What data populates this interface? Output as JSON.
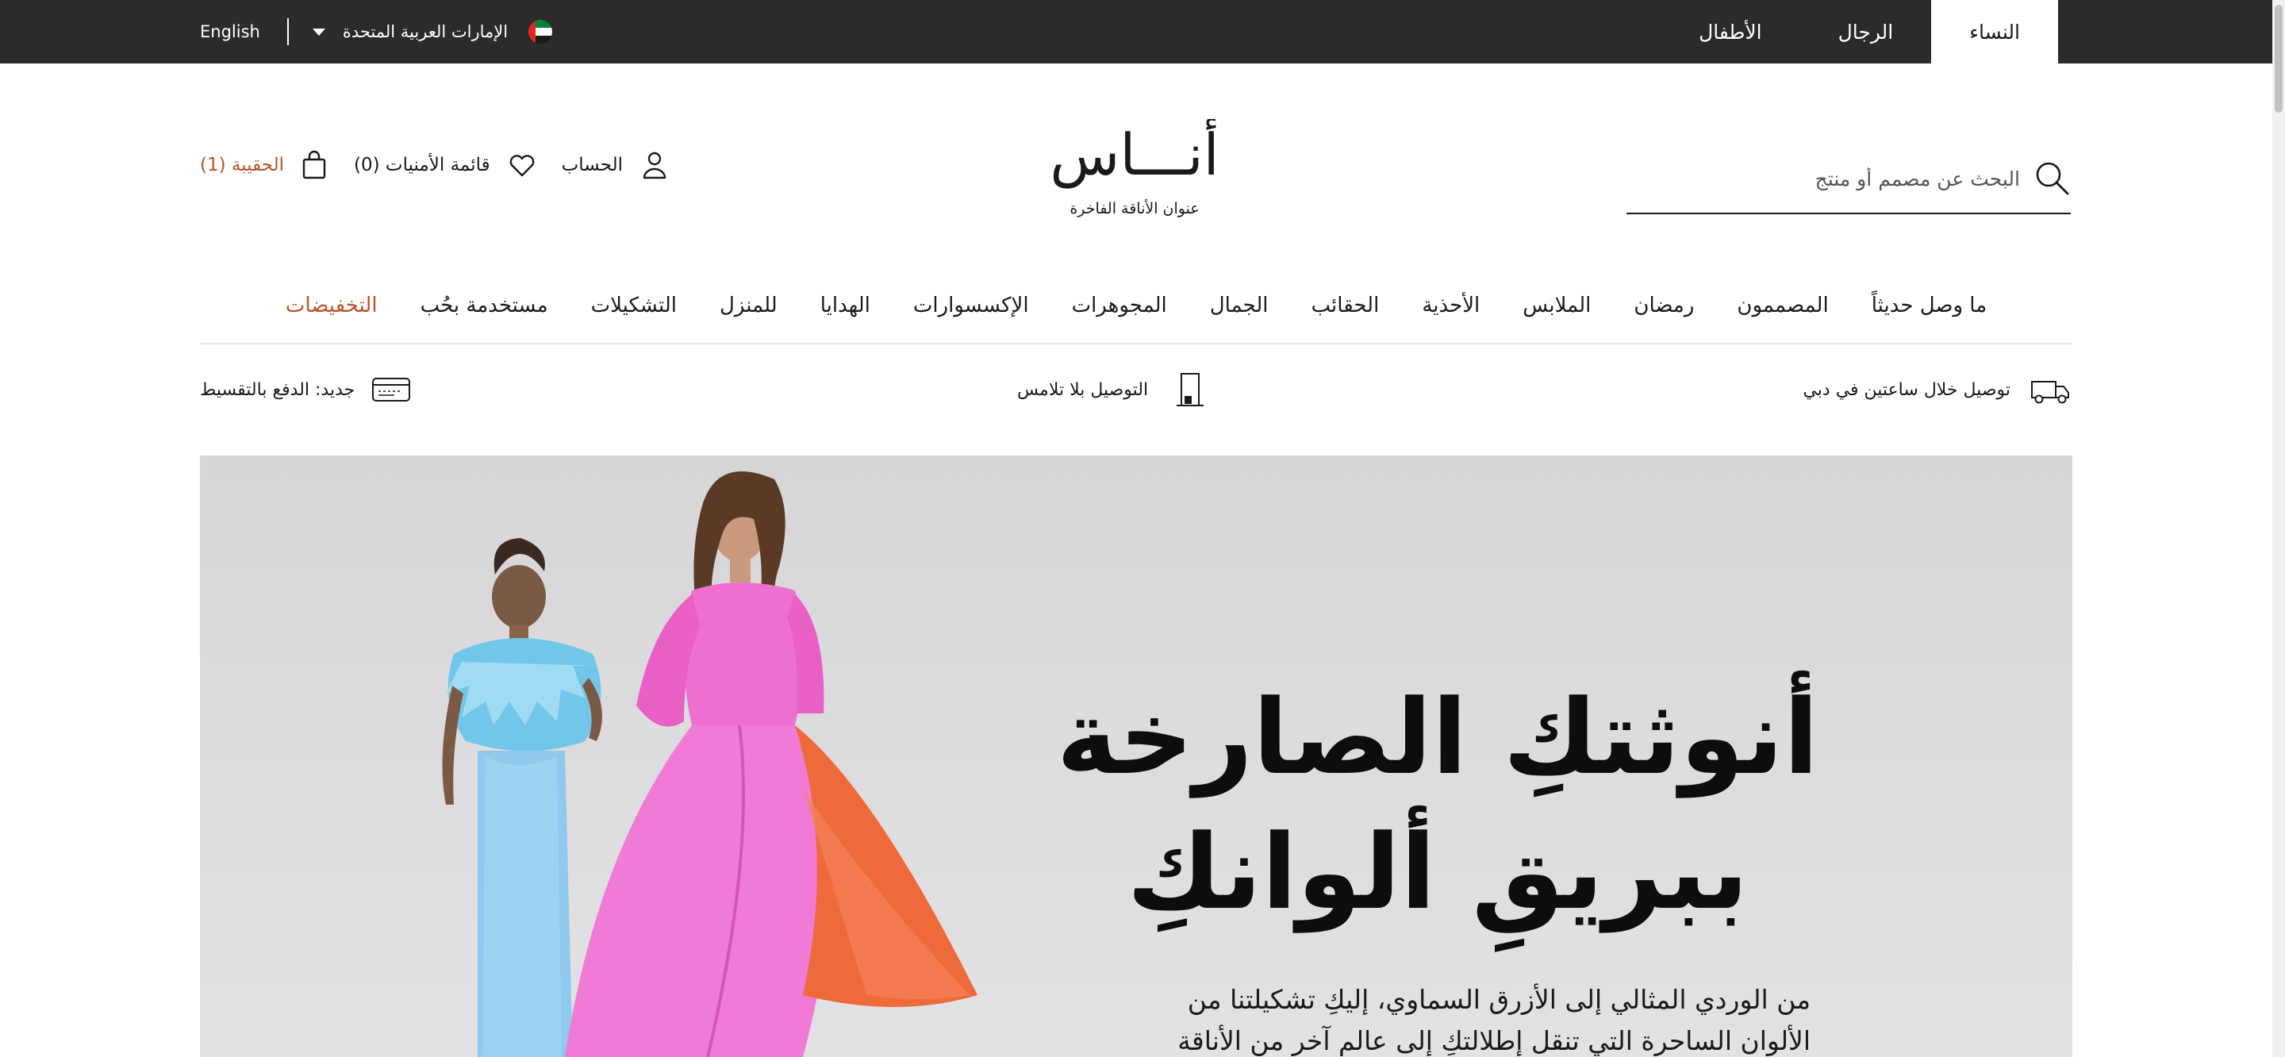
{
  "topbar": {
    "gender_tabs": [
      {
        "label": "النساء",
        "active": true
      },
      {
        "label": "الرجال",
        "active": false
      },
      {
        "label": "الأطفال",
        "active": false
      }
    ],
    "language": "English",
    "country": "الإمارات العربية المتحدة",
    "flag_icon": "uae-flag-icon"
  },
  "header": {
    "search_placeholder": "البحث عن مصمم أو منتج",
    "logo_text": "أنـــاس",
    "tagline": "عنوان الأناقة الفاخرة",
    "account_label": "الحساب",
    "wishlist_label": "قائمة الأمنيات (0)",
    "bag_label": "الحقيبة (1)"
  },
  "nav": {
    "items": [
      "ما وصل حديثاً",
      "المصممون",
      "رمضان",
      "الملابس",
      "الأحذية",
      "الحقائب",
      "الجمال",
      "المجوهرات",
      "الإكسسوارات",
      "الهدايا",
      "للمنزل",
      "التشكيلات",
      "مستخدمة بحُب"
    ],
    "sale": "التخفيضات"
  },
  "perks": {
    "delivery": "توصيل خلال ساعتين في دبي",
    "contactless": "التوصيل بلا تلامس",
    "installments": "جديد: الدفع بالتقسيط"
  },
  "hero": {
    "title_line1": "أنوثتكِ الصارخة",
    "title_line2": "ببريقِ ألوانكِ",
    "subtitle": "من الوردي المثالي إلى الأزرق السماوي، إليكِ تشكيلتنا من الألوان الساحرة التي تنقل إطلالتكِ إلى عالمٍ آخر من الأناقة"
  },
  "colors": {
    "topbar_bg": "#2b2b2b",
    "accent": "#b8542a",
    "text": "#1a1a1a"
  }
}
